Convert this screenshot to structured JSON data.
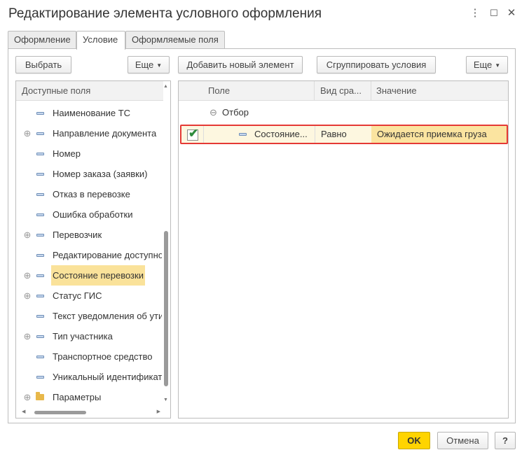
{
  "window": {
    "title": "Редактирование элемента условного оформления",
    "more_icon": "⋮",
    "maximize_icon": "☐",
    "close_icon": "✕"
  },
  "tabs": [
    {
      "label": "Оформление",
      "active": false
    },
    {
      "label": "Условие",
      "active": true
    },
    {
      "label": "Оформляемые поля",
      "active": false
    }
  ],
  "left_panel": {
    "select_button": "Выбрать",
    "more_button": "Еще",
    "header": "Доступные поля",
    "items": [
      {
        "label": "Наименование ТС",
        "expandable": false,
        "icon": "field-icon"
      },
      {
        "label": "Направление документа",
        "expandable": true,
        "icon": "field-icon"
      },
      {
        "label": "Номер",
        "expandable": false,
        "icon": "field-icon"
      },
      {
        "label": "Номер заказа (заявки)",
        "expandable": false,
        "icon": "field-icon"
      },
      {
        "label": "Отказ в перевозке",
        "expandable": false,
        "icon": "field-icon"
      },
      {
        "label": "Ошибка обработки",
        "expandable": false,
        "icon": "field-icon"
      },
      {
        "label": "Перевозчик",
        "expandable": true,
        "icon": "field-icon"
      },
      {
        "label": "Редактирование доступности",
        "expandable": false,
        "icon": "field-icon"
      },
      {
        "label": "Состояние перевозки",
        "expandable": true,
        "icon": "field-icon",
        "selected": true
      },
      {
        "label": "Статус ГИС",
        "expandable": true,
        "icon": "field-icon"
      },
      {
        "label": "Текст уведомления об утилизации",
        "expandable": false,
        "icon": "field-icon"
      },
      {
        "label": "Тип участника",
        "expandable": true,
        "icon": "field-icon"
      },
      {
        "label": "Транспортное средство",
        "expandable": false,
        "icon": "field-icon"
      },
      {
        "label": "Уникальный идентификатор",
        "expandable": false,
        "icon": "field-icon"
      },
      {
        "label": "Параметры",
        "expandable": true,
        "icon": "folder-icon"
      }
    ],
    "plus_glyph": "⊕"
  },
  "right_panel": {
    "add_button": "Добавить новый элемент",
    "group_button": "Сгруппировать условия",
    "more_button": "Еще",
    "columns": {
      "field": "Поле",
      "comparison": "Вид сра...",
      "value": "Значение"
    },
    "group_row": {
      "glyph": "⊖",
      "label": "Отбор"
    },
    "condition_row": {
      "checked": true,
      "field": "Состояние...",
      "comparison": "Равно",
      "value": "Ожидается приемка груза"
    },
    "highlight_color": "#e53935",
    "value_cell_color": "#fbe4a0"
  },
  "footer": {
    "ok": "OK",
    "cancel": "Отмена",
    "help": "?",
    "ok_color": "#ffd400"
  }
}
